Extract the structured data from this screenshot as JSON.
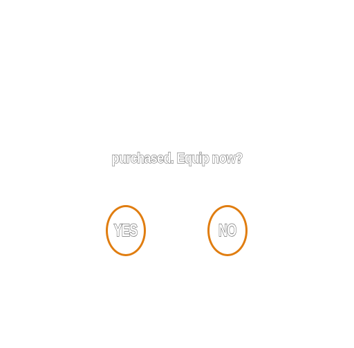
{
  "dialog": {
    "message": "purchased. Equip now?",
    "yes_label": "YES",
    "no_label": "NO"
  },
  "colors": {
    "button_ring": "#e07d10",
    "text_fill": "#ffffff",
    "text_outline": "#6b6b6b",
    "background": "#ffffff"
  }
}
